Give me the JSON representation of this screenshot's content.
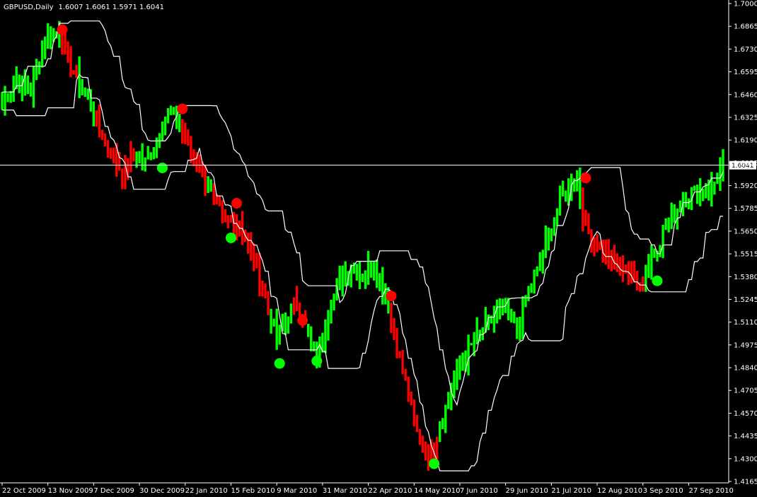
{
  "window": {
    "symbol_timeframe": "GBPUSD,Daily",
    "ohlc": "1.6007 1.6061 1.5971 1.6041"
  },
  "colors": {
    "background": "#000000",
    "bull_bar": "#00ff00",
    "bear_bar": "#ff0000",
    "channel_line": "#ffffff",
    "axis": "#ffffff"
  },
  "chart_data": {
    "type": "bar",
    "title": "GBPUSD,Daily",
    "subtitle": "1.6007 1.6061 1.5971 1.6041",
    "ylim": [
      1.4165,
      1.7
    ],
    "yticks": [
      1.7,
      1.6865,
      1.673,
      1.6595,
      1.646,
      1.6325,
      1.619,
      1.6055,
      1.592,
      1.5785,
      1.565,
      1.5515,
      1.538,
      1.5245,
      1.511,
      1.4975,
      1.484,
      1.4705,
      1.457,
      1.4435,
      1.43,
      1.4165
    ],
    "ytick_labels": [
      "1.7000",
      "1.6865",
      "1.6730",
      "1.6595",
      "1.6460",
      "1.6325",
      "1.6190",
      "1.6055",
      "1.5920",
      "1.5785",
      "1.5650",
      "1.5515",
      "1.5380",
      "1.5245",
      "1.5110",
      "1.4975",
      "1.4840",
      "1.4705",
      "1.4570",
      "1.4435",
      "1.4300",
      "1.4165"
    ],
    "current_price": 1.6041,
    "xtick_labels": [
      "22 Oct 2009",
      "13 Nov 2009",
      "7 Dec 2009",
      "30 Dec 2009",
      "22 Jan 2010",
      "15 Feb 2010",
      "9 Mar 2010",
      "31 Mar 2010",
      "22 Apr 2010",
      "14 May 2010",
      "7 Jun 2010",
      "29 Jun 2010",
      "21 Jul 2010",
      "12 Aug 2010",
      "3 Sep 2010",
      "27 Sep 2010"
    ],
    "xtick_bar_index": [
      0,
      16,
      32,
      48,
      64,
      80,
      96,
      112,
      128,
      144,
      160,
      176,
      192,
      208,
      224,
      240
    ],
    "bar_count": 253,
    "path_anchors": [
      [
        0,
        1.64
      ],
      [
        5,
        1.655
      ],
      [
        10,
        1.648
      ],
      [
        15,
        1.68
      ],
      [
        20,
        1.683
      ],
      [
        24,
        1.662
      ],
      [
        30,
        1.645
      ],
      [
        34,
        1.625
      ],
      [
        38,
        1.612
      ],
      [
        43,
        1.598
      ],
      [
        46,
        1.612
      ],
      [
        50,
        1.605
      ],
      [
        53,
        1.615
      ],
      [
        58,
        1.635
      ],
      [
        62,
        1.628
      ],
      [
        66,
        1.612
      ],
      [
        70,
        1.6
      ],
      [
        74,
        1.583
      ],
      [
        78,
        1.568
      ],
      [
        83,
        1.572
      ],
      [
        87,
        1.552
      ],
      [
        92,
        1.525
      ],
      [
        96,
        1.5
      ],
      [
        100,
        1.515
      ],
      [
        103,
        1.525
      ],
      [
        107,
        1.502
      ],
      [
        110,
        1.487
      ],
      [
        114,
        1.52
      ],
      [
        118,
        1.535
      ],
      [
        122,
        1.545
      ],
      [
        126,
        1.54
      ],
      [
        130,
        1.545
      ],
      [
        134,
        1.528
      ],
      [
        137,
        1.505
      ],
      [
        141,
        1.475
      ],
      [
        145,
        1.445
      ],
      [
        149,
        1.43
      ],
      [
        152,
        1.445
      ],
      [
        156,
        1.465
      ],
      [
        160,
        1.485
      ],
      [
        165,
        1.5
      ],
      [
        170,
        1.51
      ],
      [
        175,
        1.52
      ],
      [
        180,
        1.505
      ],
      [
        184,
        1.53
      ],
      [
        188,
        1.545
      ],
      [
        192,
        1.57
      ],
      [
        197,
        1.59
      ],
      [
        201,
        1.595
      ],
      [
        204,
        1.565
      ],
      [
        208,
        1.558
      ],
      [
        212,
        1.55
      ],
      [
        216,
        1.545
      ],
      [
        220,
        1.54
      ],
      [
        224,
        1.535
      ],
      [
        228,
        1.555
      ],
      [
        233,
        1.57
      ],
      [
        238,
        1.585
      ],
      [
        243,
        1.588
      ],
      [
        248,
        1.59
      ],
      [
        252,
        1.604
      ]
    ],
    "bear_ranges": [
      [
        21,
        26
      ],
      [
        33,
        46
      ],
      [
        63,
        71
      ],
      [
        74,
        93
      ],
      [
        102,
        106
      ],
      [
        136,
        152
      ],
      [
        203,
        224
      ]
    ],
    "signals": [
      {
        "type": "sell",
        "bar": 21,
        "price": 1.6845
      },
      {
        "type": "sell",
        "bar": 63,
        "price": 1.6375
      },
      {
        "type": "buy",
        "bar": 56,
        "price": 1.6025
      },
      {
        "type": "sell",
        "bar": 82,
        "price": 1.5815
      },
      {
        "type": "buy",
        "bar": 80,
        "price": 1.561
      },
      {
        "type": "buy",
        "bar": 97,
        "price": 1.4865
      },
      {
        "type": "sell",
        "bar": 105,
        "price": 1.512
      },
      {
        "type": "buy",
        "bar": 110,
        "price": 1.488
      },
      {
        "type": "sell",
        "bar": 136,
        "price": 1.5265
      },
      {
        "type": "buy",
        "bar": 151,
        "price": 1.427
      },
      {
        "type": "sell",
        "bar": 204,
        "price": 1.5965
      },
      {
        "type": "buy",
        "bar": 229,
        "price": 1.5355
      }
    ]
  }
}
